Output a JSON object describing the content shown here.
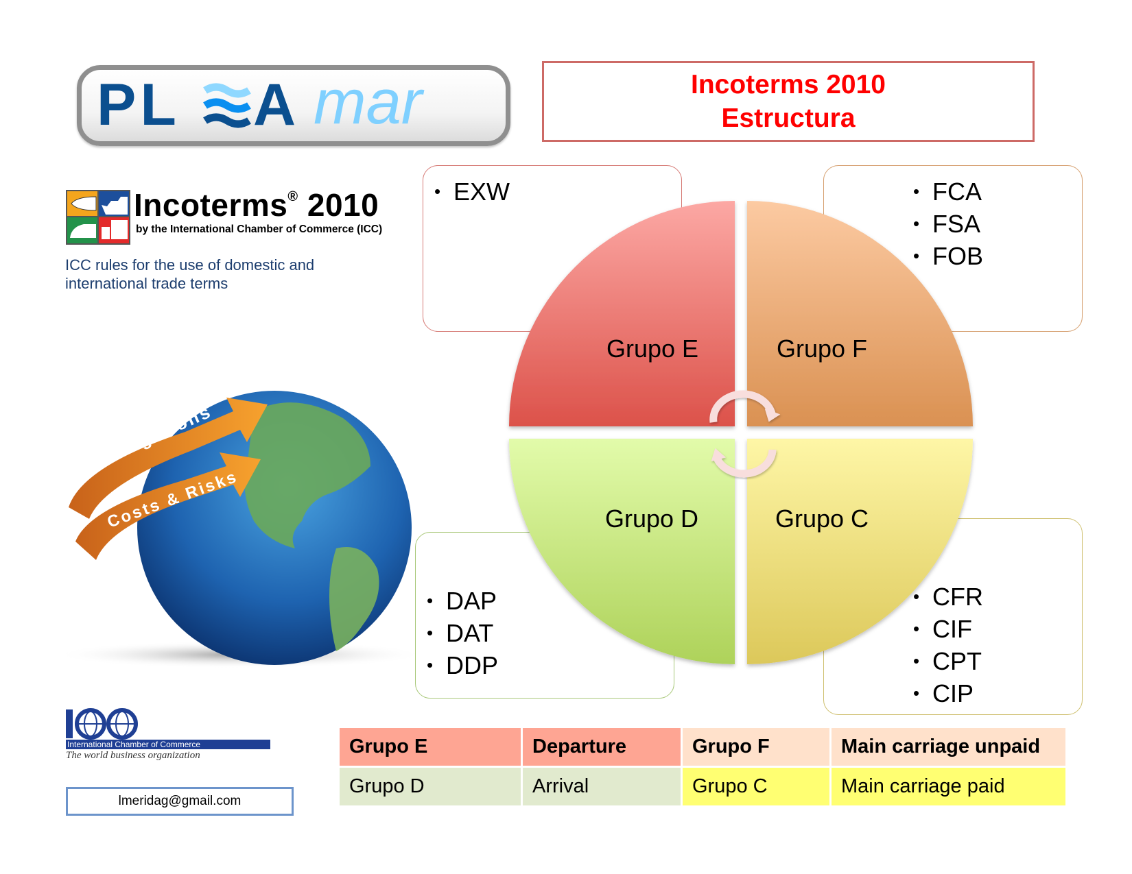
{
  "logo": {
    "brand_dark": "PL",
    "brand_wave": "wave-icon",
    "brand_a": "A",
    "brand_light": "mar",
    "colors": {
      "dark_blue": "#0b4f8f",
      "light_blue": "#7fd0ff",
      "wave_mid": "#0a8ff0"
    }
  },
  "title": {
    "line1": "Incoterms 2010",
    "line2": "Estructura",
    "color": "#ff0000"
  },
  "incoterms_logo": {
    "title": "Incoterms",
    "registered": "®",
    "year": "2010",
    "subtitle": "by the International Chamber of Commerce (ICC)",
    "icons": [
      "airplane-icon",
      "ship-icon",
      "train-icon",
      "truck-icon"
    ],
    "icon_colors": [
      "#f4a51d",
      "#1d4f9c",
      "#23924a",
      "#e32a2a"
    ]
  },
  "icc_rules_text": [
    "ICC rules for the use of domestic and",
    "international trade terms"
  ],
  "globe": {
    "arrow_top": "Obligations",
    "arrow_bottom": "Costs & Risks"
  },
  "icc_logo": {
    "mark": "ICC",
    "band": "International Chamber of Commerce",
    "tagline": "The world business organization"
  },
  "email": "lmeridag@gmail.com",
  "diagram": {
    "quadrants": [
      {
        "id": "E",
        "label": "Grupo E",
        "position": "top-left",
        "color_top": "#fca8a4",
        "color_bottom": "#dc524a",
        "terms": [
          "EXW"
        ]
      },
      {
        "id": "F",
        "label": "Grupo F",
        "position": "top-right",
        "color_top": "#fccaa2",
        "color_bottom": "#da9152",
        "terms": [
          "FCA",
          "FSA",
          "FOB"
        ]
      },
      {
        "id": "D",
        "label": "Grupo D",
        "position": "bottom-left",
        "color_top": "#e2fbaa",
        "color_bottom": "#aed25a",
        "terms": [
          "DAP",
          "DAT",
          "DDP"
        ]
      },
      {
        "id": "C",
        "label": "Grupo C",
        "position": "bottom-right",
        "color_top": "#fef6a6",
        "color_bottom": "#dcc85a",
        "terms": [
          "CFR",
          "CIF",
          "CPT",
          "CIP"
        ]
      }
    ],
    "cycle_arrows": [
      "cycle-arrow-top-icon",
      "cycle-arrow-bottom-icon"
    ]
  },
  "summary_table": {
    "rows": [
      {
        "cells": [
          "Grupo E",
          "Departure",
          "Grupo F",
          "Main carriage unpaid"
        ],
        "colors": [
          "#fea593",
          "#fea593",
          "#ffe1cb",
          "#ffe1cb"
        ]
      },
      {
        "cells": [
          "Grupo D",
          "Arrival",
          "Grupo C",
          "Main carriage paid"
        ],
        "colors": [
          "#e1eace",
          "#e1eace",
          "#ffff72",
          "#ffff72"
        ]
      }
    ]
  }
}
